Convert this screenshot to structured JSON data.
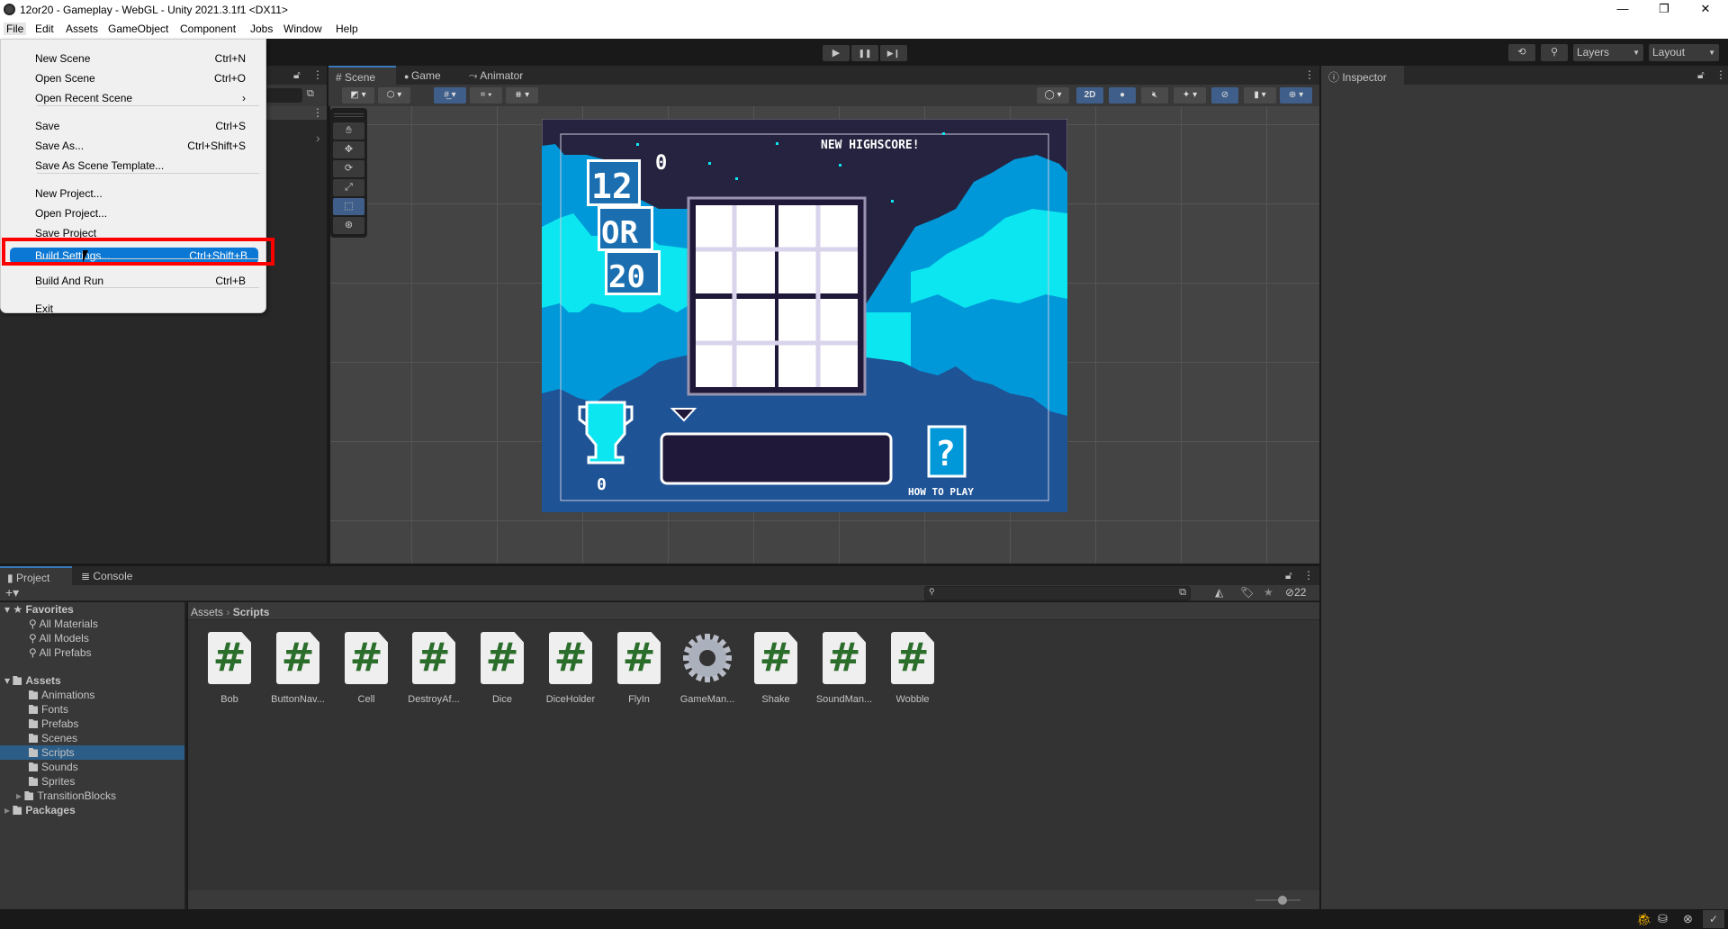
{
  "window": {
    "title": "12or20 - Gameplay - WebGL - Unity 2021.3.1f1 <DX11>",
    "minimize": "—",
    "maximize": "❐",
    "close": "✕"
  },
  "menubar": [
    "File",
    "Edit",
    "Assets",
    "GameObject",
    "Component",
    "Jobs",
    "Window",
    "Help"
  ],
  "toolbar": {
    "play": "▶",
    "pause": "❚❚",
    "step": "▶❙",
    "history_icon": "history-icon",
    "search_icon": "search-icon",
    "layers": "Layers",
    "layout": "Layout"
  },
  "file_menu": {
    "items": [
      {
        "label": "New Scene",
        "shortcut": "Ctrl+N"
      },
      {
        "label": "Open Scene",
        "shortcut": "Ctrl+O"
      },
      {
        "label": "Open Recent Scene",
        "shortcut": "›"
      },
      {
        "label": "Save",
        "shortcut": "Ctrl+S"
      },
      {
        "label": "Save As...",
        "shortcut": "Ctrl+Shift+S"
      },
      {
        "label": "Save As Scene Template...",
        "shortcut": ""
      },
      {
        "label": "New Project...",
        "shortcut": ""
      },
      {
        "label": "Open Project...",
        "shortcut": ""
      },
      {
        "label": "Save Project",
        "shortcut": ""
      },
      {
        "label": "Build Settings...",
        "shortcut": "Ctrl+Shift+B",
        "highlighted": true
      },
      {
        "label": "Build And Run",
        "shortcut": "Ctrl+B"
      },
      {
        "label": "Exit",
        "shortcut": ""
      }
    ]
  },
  "scene_tabs": [
    {
      "label": "Scene",
      "icon": "#"
    },
    {
      "label": "Game",
      "icon": "●"
    },
    {
      "label": "Animator",
      "icon": "⤳"
    }
  ],
  "scene_toolbar": {
    "mode_2d": "2D"
  },
  "game": {
    "highscore": "NEW HIGHSCORE!",
    "score": "0",
    "trophy_score": "0",
    "how_to_play": "HOW TO PLAY",
    "help": "?",
    "logo": [
      "12",
      "OR",
      "20"
    ],
    "colors": {
      "sky": "#25233f",
      "cloud_blue": "#0098d8",
      "cloud_cyan": "#0ce6f0",
      "cloud_dark": "#1e5396",
      "board": "#201838"
    }
  },
  "inspector": {
    "tab": "Inspector"
  },
  "project": {
    "tabs": [
      "Project",
      "Console"
    ],
    "add": "+▾",
    "hidden_count": "22",
    "search_placeholder": "",
    "breadcrumb": [
      "Assets",
      "Scripts"
    ],
    "favorites": {
      "label": "Favorites",
      "items": [
        "All Materials",
        "All Models",
        "All Prefabs"
      ]
    },
    "assets": {
      "label": "Assets",
      "folders": [
        "Animations",
        "Fonts",
        "Prefabs",
        "Scenes",
        "Scripts",
        "Sounds",
        "Sprites",
        "TransitionBlocks"
      ],
      "selected": "Scripts"
    },
    "packages": "Packages",
    "files": [
      {
        "name": "Bob",
        "type": "script"
      },
      {
        "name": "ButtonNav...",
        "type": "script"
      },
      {
        "name": "Cell",
        "type": "script"
      },
      {
        "name": "DestroyAf...",
        "type": "script"
      },
      {
        "name": "Dice",
        "type": "script"
      },
      {
        "name": "DiceHolder",
        "type": "script"
      },
      {
        "name": "FlyIn",
        "type": "script"
      },
      {
        "name": "GameMan...",
        "type": "gear"
      },
      {
        "name": "Shake",
        "type": "script"
      },
      {
        "name": "SoundMan...",
        "type": "script"
      },
      {
        "name": "Wobble",
        "type": "script"
      }
    ],
    "zoom_slider": 0.5
  }
}
